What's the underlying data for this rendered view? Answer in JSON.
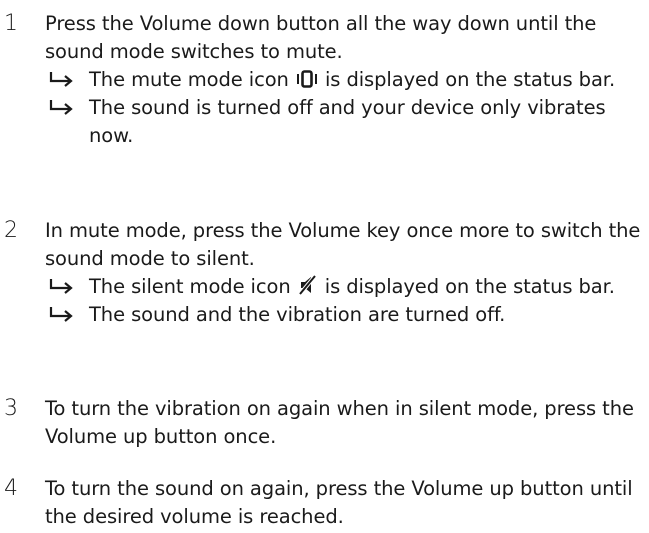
{
  "steps": [
    {
      "number": "1",
      "text": "Press the Volume down button all the way down until the sound mode switches to mute.",
      "results": [
        {
          "before": "The mute mode icon ",
          "icon": "vibrate-icon",
          "after": " is displayed on the status bar."
        },
        {
          "text": "The sound is turned off and your device only vibrates now."
        }
      ]
    },
    {
      "number": "2",
      "text": "In mute mode, press the Volume key once more to switch the sound mode to silent.",
      "results": [
        {
          "before": "The silent mode icon ",
          "icon": "silent-mode-icon",
          "after": " is displayed on the status bar."
        },
        {
          "text": "The sound and the vibration are turned off."
        }
      ]
    },
    {
      "number": "3",
      "text": "To turn the vibration on again when in silent mode, press the Volume up button once."
    },
    {
      "number": "4",
      "text": "To turn the sound on again, press the Volume up button until the desired volume is reached."
    }
  ]
}
